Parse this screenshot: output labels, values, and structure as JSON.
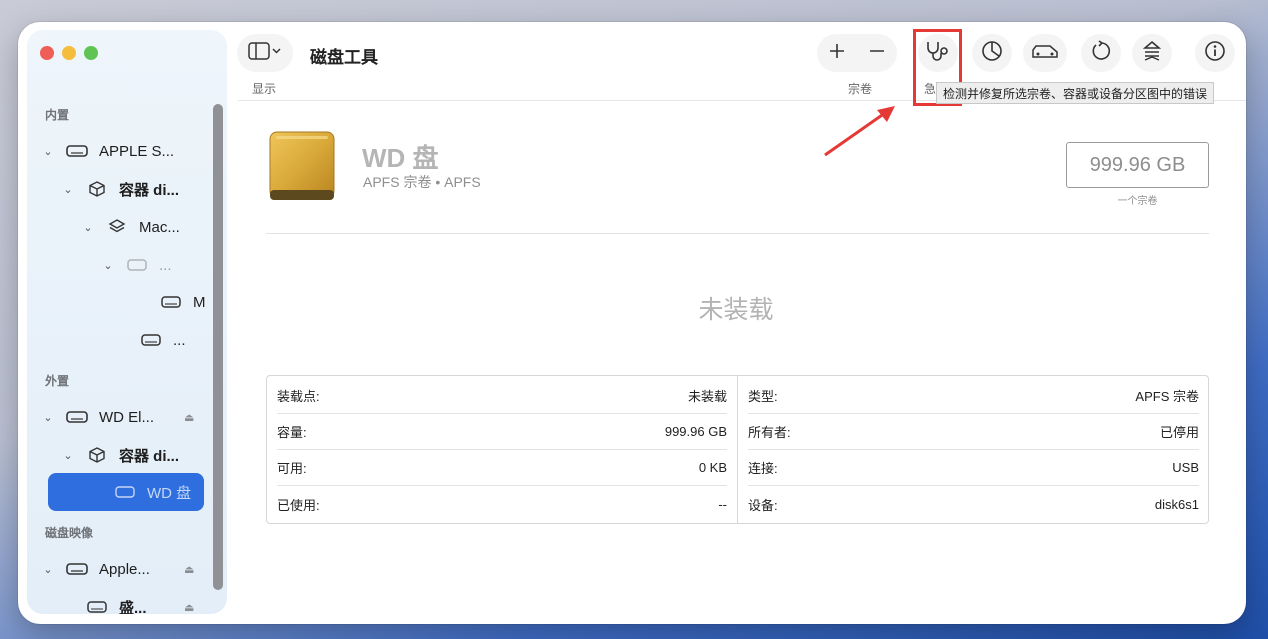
{
  "app": {
    "title": "磁盘工具"
  },
  "sidebar": {
    "sections": [
      {
        "label": "内置"
      },
      {
        "label": "外置"
      },
      {
        "label": "磁盘映像"
      }
    ],
    "items": [
      {
        "label": "APPLE S..."
      },
      {
        "label": "容器 di..."
      },
      {
        "label": "Mac..."
      },
      {
        "label": "..."
      },
      {
        "label": "M"
      },
      {
        "label": "..."
      },
      {
        "label": "WD El..."
      },
      {
        "label": "容器 di..."
      },
      {
        "label": "WD 盘"
      },
      {
        "label": "Apple..."
      },
      {
        "label": "盛..."
      }
    ]
  },
  "toolbar": {
    "view_label": "显示",
    "volume_label": "宗卷",
    "firstaid_label": "急",
    "tooltip": "检测并修复所选宗卷、容器或设备分区图中的错误",
    "icons": [
      "sidebar-icon",
      "plus-icon",
      "minus-icon",
      "stethoscope-icon",
      "partition-icon",
      "erase-icon",
      "restore-icon",
      "unmount-icon",
      "info-icon"
    ]
  },
  "volume": {
    "name": "WD 盘",
    "subtitle": "APFS 宗卷 • APFS",
    "capacity": "999.96 GB",
    "capacity_caption": "一个宗卷",
    "mount_state": "未装载"
  },
  "info": {
    "left": [
      {
        "key": "装载点:",
        "value": "未装载"
      },
      {
        "key": "容量:",
        "value": "999.96 GB"
      },
      {
        "key": "可用:",
        "value": "0 KB"
      },
      {
        "key": "已使用:",
        "value": "--"
      }
    ],
    "right": [
      {
        "key": "类型:",
        "value": "APFS 宗卷"
      },
      {
        "key": "所有者:",
        "value": "已停用"
      },
      {
        "key": "连接:",
        "value": "USB"
      },
      {
        "key": "设备:",
        "value": "disk6s1"
      }
    ]
  },
  "colors": {
    "accent": "#2f6ede",
    "highlight": "#e53935",
    "drive_gold": "#d9a93a"
  }
}
